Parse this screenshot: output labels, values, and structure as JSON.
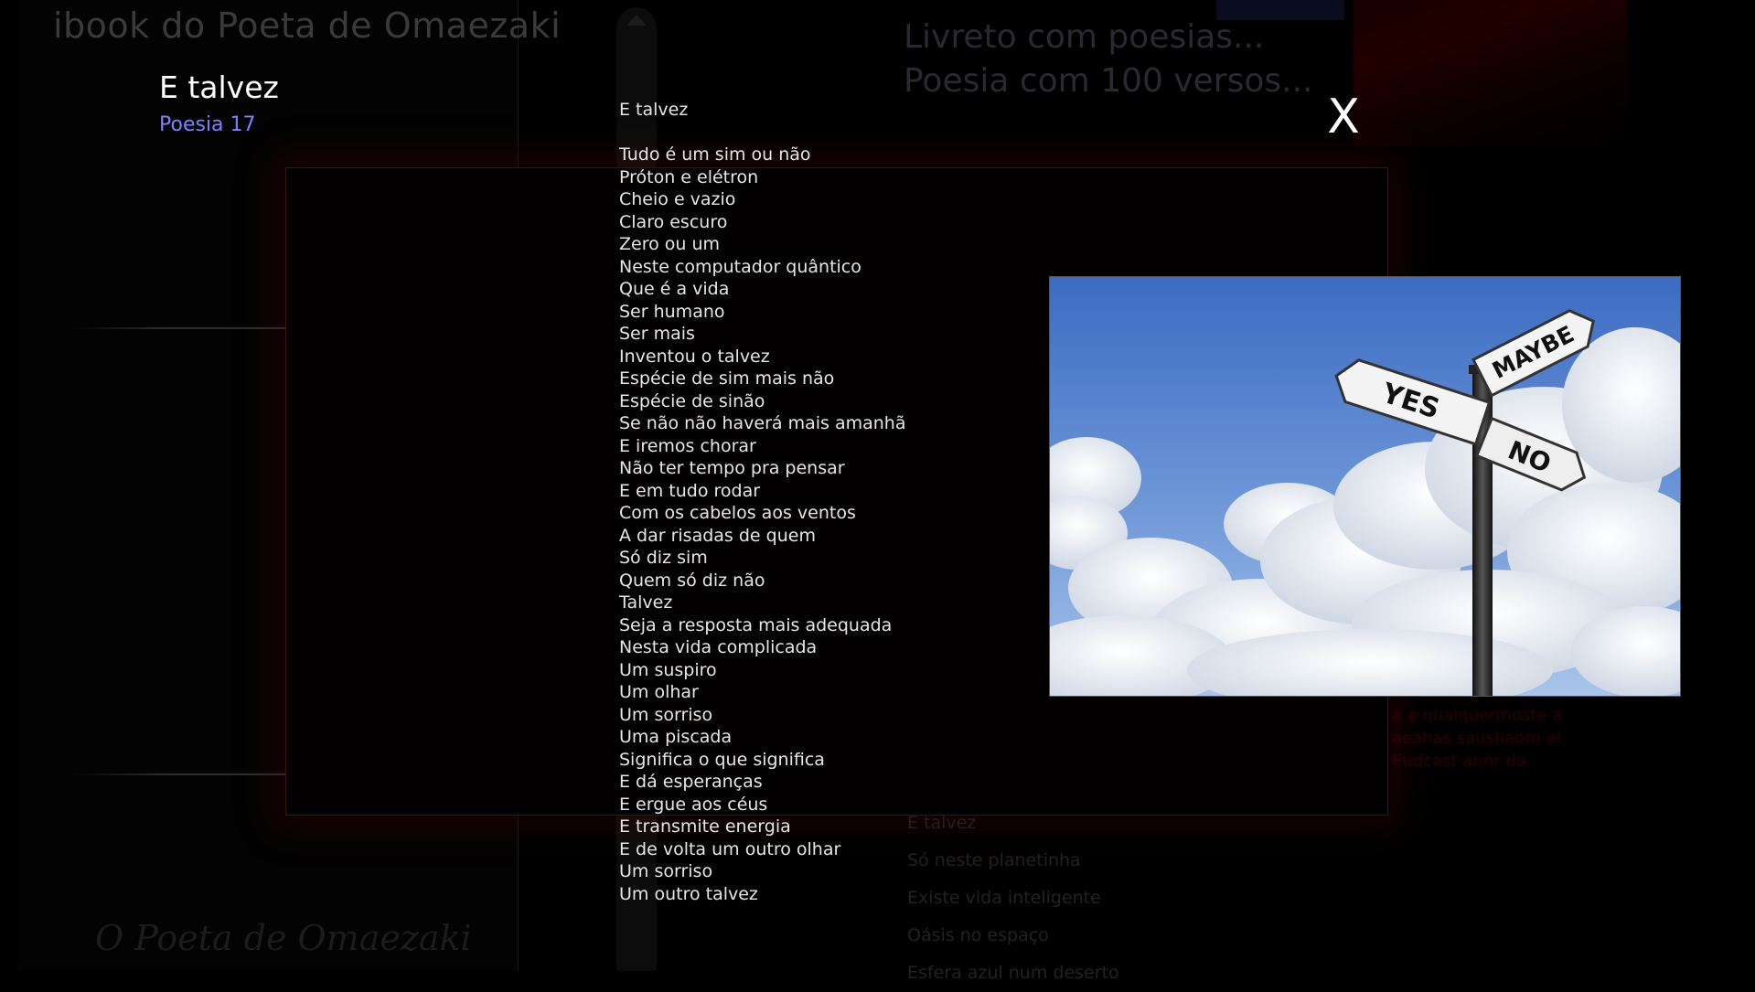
{
  "app": {
    "title": "ibook do Poeta de Omaezaki",
    "signature": "O Poeta de Omaezaki"
  },
  "background": {
    "heading_line1": "Livreto com poesias...",
    "heading_line2": "Poesia com 100 versos...",
    "red_text": "a a qualquermoste a aeahas saushaom ei Eudcast annr da",
    "list": [
      "E talvez",
      "Só neste planetinha",
      "Existe vida inteligente",
      "Oásis no espaço",
      "Esfera azul num deserto"
    ]
  },
  "poem": {
    "title": "E talvez",
    "number": "Poesia 17",
    "heading": "E talvez",
    "lines": [
      "Tudo é um sim ou não",
      "Próton e elétron",
      "Cheio e vazio",
      "Claro escuro",
      "Zero ou um",
      "Neste computador quântico",
      "Que é a vida",
      "Ser humano",
      "Ser mais",
      "Inventou o talvez",
      "Espécie de sim mais não",
      "Espécie de sinão",
      "Se não não haverá mais amanhã",
      "E iremos chorar",
      "Não ter tempo pra pensar",
      "E em tudo rodar",
      "Com os cabelos aos ventos",
      "A dar risadas de quem",
      "Só diz sim",
      "Quem só diz não",
      "Talvez",
      "Seja a resposta mais adequada",
      "Nesta vida complicada",
      "Um suspiro",
      "Um olhar",
      "Um sorriso",
      "Uma piscada",
      "Significa o que significa",
      "E dá esperanças",
      "E ergue aos céus",
      "E transmite energia",
      "E de volta um outro olhar",
      "Um sorriso",
      "Um outro talvez"
    ]
  },
  "close_label": "X",
  "signpost": {
    "yes": "YES",
    "no": "NO",
    "maybe": "MAYBE"
  },
  "colors": {
    "poem_number": "#8080ff",
    "modal_border": "#3a1212",
    "sky_top": "#3f6fc4",
    "sky_bottom": "#a9c5ec"
  }
}
